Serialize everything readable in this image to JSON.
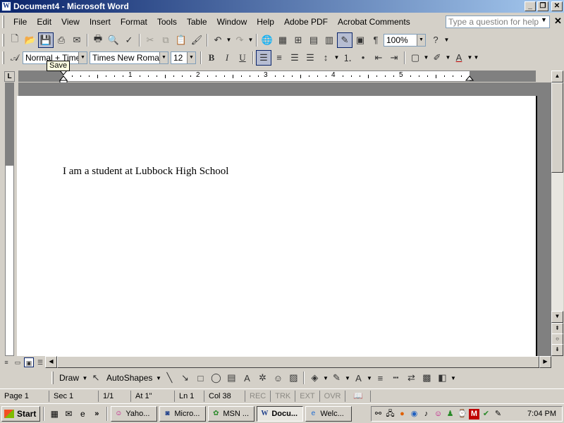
{
  "window": {
    "title": "Document4 - Microsoft Word",
    "min": "_",
    "max": "❐",
    "close": "✕"
  },
  "menu": {
    "items": [
      "File",
      "Edit",
      "View",
      "Insert",
      "Format",
      "Tools",
      "Table",
      "Window",
      "Help",
      "Adobe PDF",
      "Acrobat Comments"
    ],
    "ask_placeholder": "Type a question for help"
  },
  "toolbar": {
    "zoom": "100%",
    "style": "Normal + Times",
    "font": "Times New Roman",
    "size": "12",
    "tooltip": "Save"
  },
  "ruler": {
    "marks": [
      "1",
      "2",
      "3",
      "4",
      "5"
    ]
  },
  "document": {
    "text": "I am a student at Lubbock High School"
  },
  "drawbar": {
    "draw": "Draw",
    "autoshapes": "AutoShapes"
  },
  "status": {
    "page": "Page 1",
    "sec": "Sec 1",
    "pages": "1/1",
    "at": "At 1\"",
    "ln": "Ln 1",
    "col": "Col 38",
    "rec": "REC",
    "trk": "TRK",
    "ext": "EXT",
    "ovr": "OVR"
  },
  "taskbar": {
    "start": "Start",
    "tasks": [
      "Yaho...",
      "Micro...",
      "MSN ...",
      "Docu...",
      "Welc..."
    ],
    "clock": "7:04 PM"
  }
}
